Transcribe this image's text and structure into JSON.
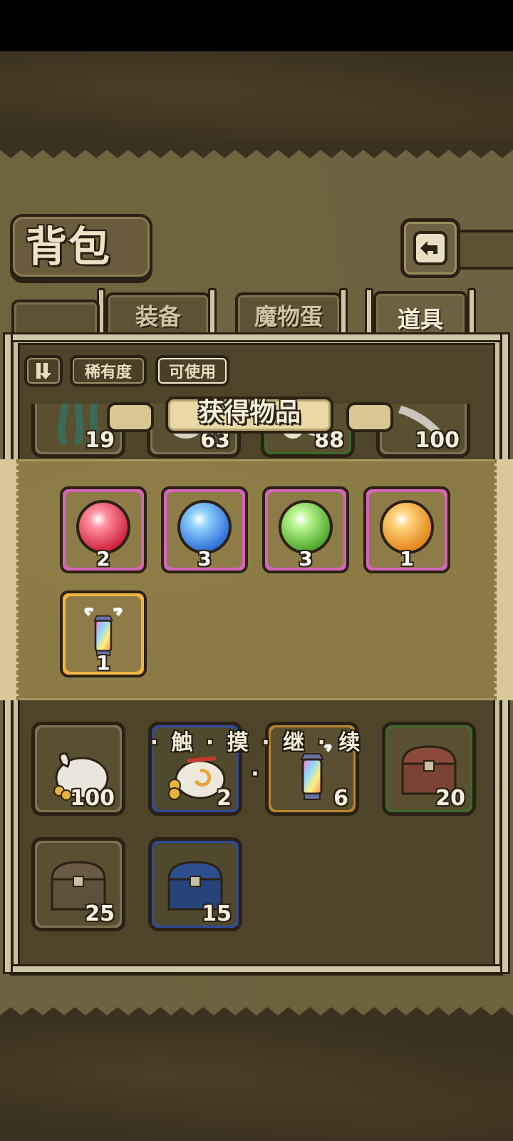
{
  "header": {
    "title": "背包"
  },
  "tabs": [
    {
      "label": "装备",
      "active": false
    },
    {
      "label": "魔物蛋",
      "active": false
    },
    {
      "label": "道具",
      "active": true
    }
  ],
  "filters": {
    "sort_icon": "sort-toggle-icon",
    "rarity_label": "稀有度",
    "usable_label": "可使用"
  },
  "partial_items_top": [
    "19",
    "63",
    "88",
    "100"
  ],
  "inventory": [
    {
      "name": "coin-sack",
      "count": "100",
      "frame": "gray"
    },
    {
      "name": "lucky-coin-sack",
      "count": "2",
      "frame": "blue"
    },
    {
      "name": "angel-lantern",
      "count": "6",
      "frame": "gold"
    },
    {
      "name": "wooden-chest",
      "count": "20",
      "frame": "green"
    },
    {
      "name": "iron-chest",
      "count": "25",
      "frame": "gray"
    },
    {
      "name": "blue-chest",
      "count": "15",
      "frame": "blue"
    }
  ],
  "reward_popup": {
    "title": "获得物品",
    "items": [
      {
        "name": "red-orb",
        "count": "2",
        "color": "#e8384f"
      },
      {
        "name": "blue-orb",
        "count": "3",
        "color": "#2f86e0"
      },
      {
        "name": "green-orb",
        "count": "3",
        "color": "#55c22e"
      },
      {
        "name": "orange-orb",
        "count": "1",
        "color": "#f39a1c"
      },
      {
        "name": "angel-lantern",
        "count": "1",
        "color": "#f0b540"
      }
    ],
    "continue_chars": [
      "触",
      "摸",
      "继",
      "续"
    ]
  }
}
